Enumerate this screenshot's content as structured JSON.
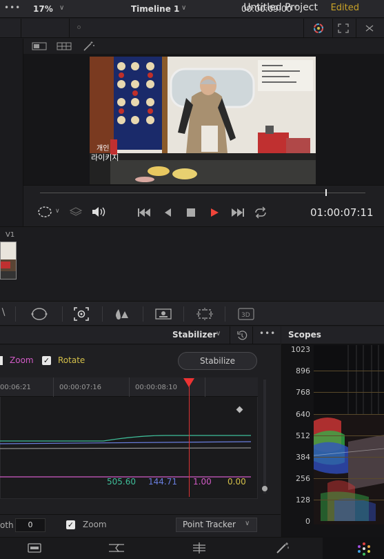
{
  "titlebar": {
    "title": "Untitled Project",
    "status": "Edited"
  },
  "viewer_header": {
    "menu_glyph": "•••",
    "zoom": "17%",
    "timeline_name": "Timeline 1",
    "timecode": "00:00:09:00"
  },
  "viewer": {
    "overlay_text_line1": "개인",
    "overlay_text_line2": "라이키지",
    "playback_timecode": "01:00:07:11",
    "scrub_position": 0.88
  },
  "timeline": {
    "track_label": "V1"
  },
  "stabilizer": {
    "title": "Stabilizer",
    "menu_glyph": "•••",
    "zoom_label": "Zoom",
    "rotate_label": "Rotate",
    "stabilize_button": "Stabilize",
    "ruler": [
      "00:06:21",
      "00:00:07:16",
      "00:00:08:10"
    ],
    "values": {
      "green": "505.60",
      "blue": "144.71",
      "magenta": "1.00",
      "yellow": "0.00"
    },
    "smooth_label": "oth",
    "smooth_value": "0",
    "zoom2_label": "Zoom",
    "tracker_mode": "Point Tracker"
  },
  "scopes": {
    "title": "Scopes",
    "labels": [
      "1023",
      "896",
      "768",
      "640",
      "512",
      "384",
      "256",
      "128",
      "0"
    ]
  },
  "colors": {
    "accent_edited": "#c9a227",
    "playhead": "#e33333",
    "zoom_magenta": "#d25bc7",
    "rotate_yellow": "#d4c04a",
    "value_green": "#3fbf9a",
    "value_blue": "#6a7fe0"
  },
  "icons": {
    "header": [
      "color-wheel-icon",
      "fullscreen-icon"
    ],
    "transport": [
      "loop-select-icon",
      "layers-icon",
      "speaker-icon",
      "skip-start-icon",
      "step-back-icon",
      "stop-icon",
      "play-icon",
      "skip-end-icon",
      "loop-icon"
    ],
    "palette": [
      "circle-window-icon",
      "tracker-icon",
      "qualifier-icon",
      "window-icon",
      "sizing-icon",
      "3d-icon"
    ],
    "pages": [
      "media-page-icon",
      "cut-page-icon",
      "edit-page-icon",
      "fusion-page-icon",
      "color-page-icon"
    ]
  }
}
